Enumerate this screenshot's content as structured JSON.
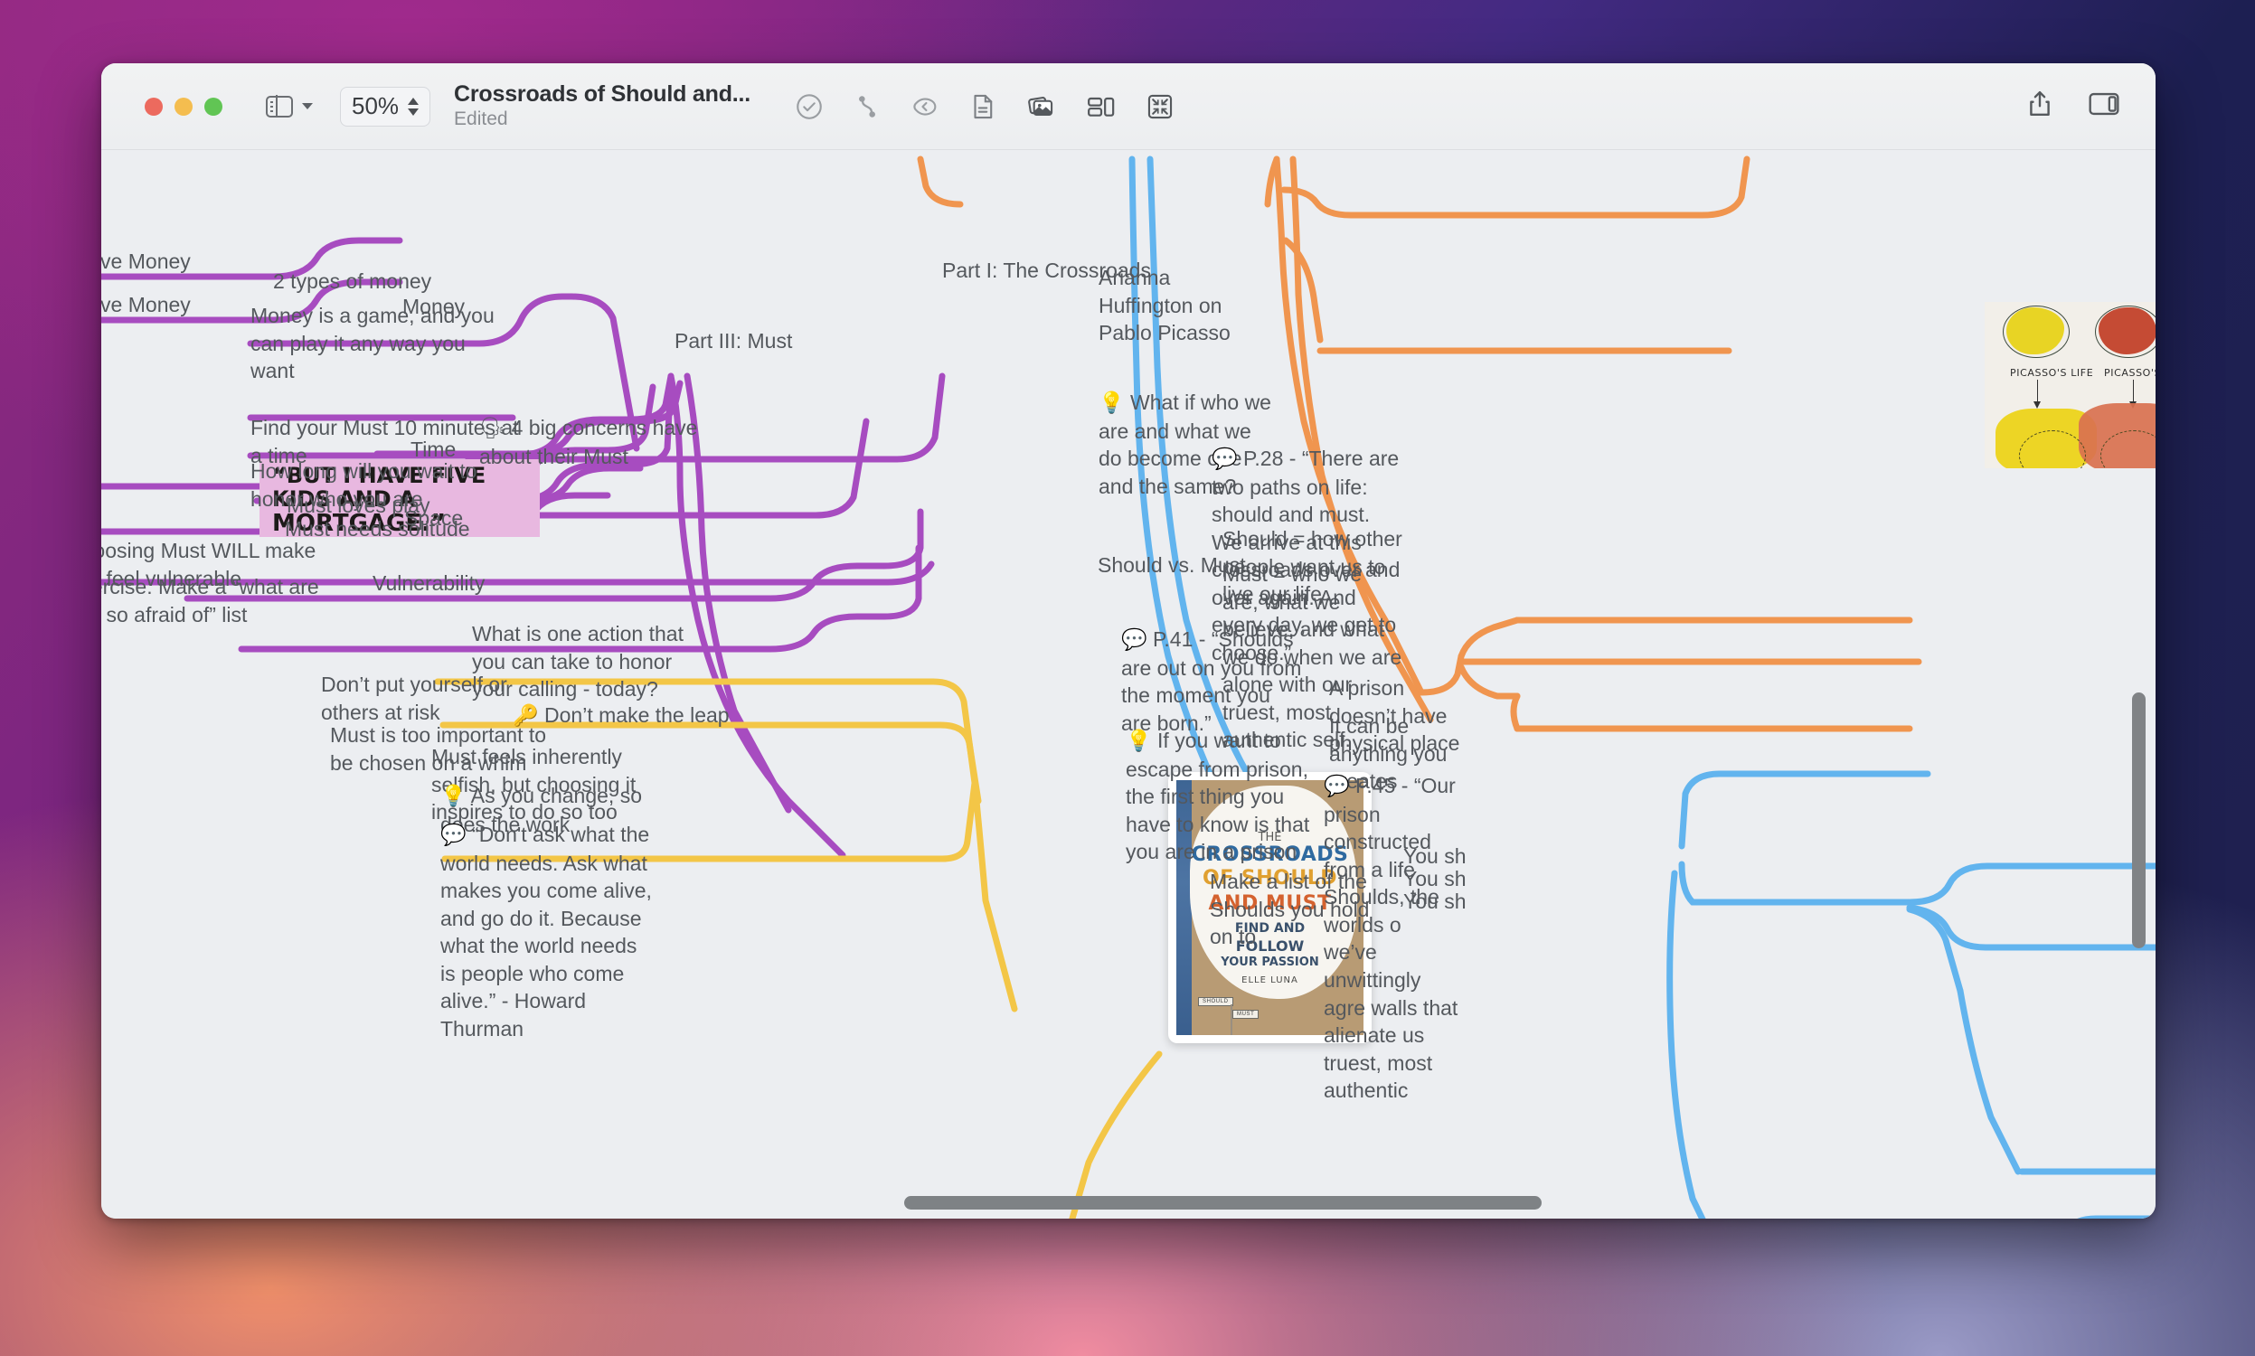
{
  "window": {
    "traffic_lights": [
      "close",
      "minimize",
      "maximize"
    ],
    "sidebar_toggle_label": "sidebar-toggle",
    "zoom_value": "50%",
    "title": "Crossroads of Should and...",
    "subtitle": "Edited",
    "toolbar_icons": [
      "task-check-icon",
      "relationship-link-icon",
      "boundary-icon",
      "note-document-icon",
      "images-icon",
      "layout-icon",
      "focus-collapse-icon"
    ],
    "toolbar_right_icons": [
      "share-icon",
      "inspector-panel-icon"
    ]
  },
  "map": {
    "center_image": {
      "name": "book-cover",
      "lines": [
        "THE",
        "CROSSROADS",
        "OF SHOULD",
        "AND MUST",
        "FIND AND",
        "FOLLOW",
        "YOUR PASSION",
        "ELLE LUNA"
      ],
      "signposts": [
        "SHOULD",
        "MUST"
      ]
    },
    "picasso_image": {
      "name": "picasso-life-art-diagram",
      "captions": [
        "PICASSO'S LIFE",
        "PICASSO'S ART"
      ]
    },
    "sticky_image": {
      "name": "mortgage-sticky-note",
      "lines": [
        "“BUT I HAVE FIVE",
        "KIDS AND A",
        "MORTGAGE.”"
      ]
    },
    "branches": {
      "purple": "#a74cc0",
      "orange": "#f0954f",
      "yellow": "#f3c647",
      "blue": "#62b4ee"
    },
    "nodes": {
      "have_money_1": "-Have Money",
      "have_money_2": "-Have Money",
      "two_types_of_money": "2 types of money",
      "money_game": "Money is a game, and you can play it any way you want",
      "money": "Money",
      "part_iii_must": "Part III: Must",
      "find_your_must": "Find your Must 10 minutes at a time",
      "time": "Time",
      "four_big_concerns": "4 big concerns have about their Must",
      "how_long_wait": "How long will you wait to honor who you are",
      "must_loves_play": "Must loves play",
      "space": "Space",
      "must_needs_solitude": "Must needs solitude",
      "choosing_must_vulnerable": "Choosing Must WILL make you feel vulnerable",
      "vulnerability": "Vulnerability",
      "exercise_afraid_list": "Exercise: Make a “what are you so afraid of” list",
      "one_action_today": "What is one action that you can take to honor your calling - today?",
      "dont_put_at_risk": "Don’t put yourself or others at risk",
      "dont_make_the_leap": "Don’t make the leap",
      "must_too_important": "Must is too important to be chosen on a whim",
      "must_feels_selfish": "Must feels inherently selfish, but choosing it inspires to do so too",
      "as_you_change": "As you change, so does the work",
      "howard_thurman_quote": "“Don't ask what the world needs. Ask what makes you come alive, and go do it. Because what the world needs is people who come alive.” - Howard Thurman",
      "part_i_crossroads": "Part I: The Crossroads",
      "arianna_on_picasso": "Arianna Huffington on Pablo Picasso",
      "what_if_who_we_are": "What if who we are and what we do become one and the same?",
      "p28_quote": "P.28 - “There are two paths on life: should and must. We arrive at this crossroads over and over again. And every day, we get to choose.”",
      "should_vs_must": "Should vs. Must",
      "should_definition": "Should = how other people want us to live our life",
      "must_definition": "Must = who we are, what we believe, and what we do when we are alone with our truest, most authentic self.",
      "p41_quote": "P.41 - “Shoulds are out on you from the moment you are born.”",
      "escape_prison": "If you want to escape from prison, the first thing you have to know is that you are in a prison",
      "prison_no_physical_place": "A prison doesn’t have physical place",
      "can_be_anything": "It can be anything you creates",
      "p45_quote": "P.45 - “Our prison constructed from a life Shoulds, the worlds o we’ve unwittingly agre walls that alienate us truest, most authentic",
      "make_list_shoulds": "Make a list of the Shoulds you hold on to",
      "you_sh_1": "You sh",
      "you_sh_2": "You sh",
      "you_sh_3": "You sh"
    },
    "icons": {
      "speech": "💬",
      "bulb": "💡",
      "key": "🔑",
      "head": "🗣"
    }
  },
  "scrollbars": {
    "vertical": "vertical-scrollbar",
    "horizontal": "horizontal-scrollbar"
  }
}
